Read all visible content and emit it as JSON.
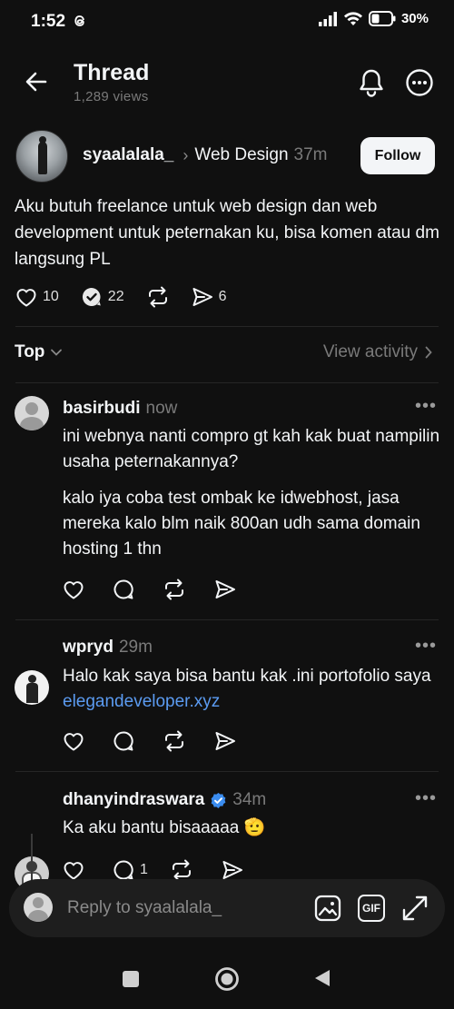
{
  "status_bar": {
    "time": "1:52",
    "battery": "30%"
  },
  "header": {
    "title": "Thread",
    "views": "1,289 views"
  },
  "post": {
    "username": "syaalalala_",
    "topic": "Web Design",
    "time": "37m",
    "follow_label": "Follow",
    "text": "Aku butuh freelance untuk  web design dan web development untuk peternakan ku, bisa komen atau dm langsung PL",
    "likes": "10",
    "replies": "22",
    "shares": "6"
  },
  "sort": {
    "label": "Top",
    "view_activity": "View activity"
  },
  "comments": [
    {
      "username": "basirbudi",
      "time": "now",
      "paragraphs": [
        "ini webnya nanti compro gt kah kak buat nampilin usaha peternakannya?",
        "kalo iya coba test ombak ke idwebhost, jasa mereka kalo blm naik 800an udh sama domain hosting 1 thn"
      ]
    },
    {
      "username": "wpryd",
      "time": "29m",
      "text": "Halo kak saya bisa bantu kak .ini portofolio saya ",
      "link": "elegandeveloper.xyz"
    },
    {
      "username": "dhanyindraswara",
      "time": "34m",
      "text": "Ka aku bantu bisaaaaa",
      "emoji": "🫡",
      "reply_count": "1"
    }
  ],
  "reply_bar": {
    "placeholder": "Reply to syaalalala_",
    "gif_label": "GIF"
  }
}
